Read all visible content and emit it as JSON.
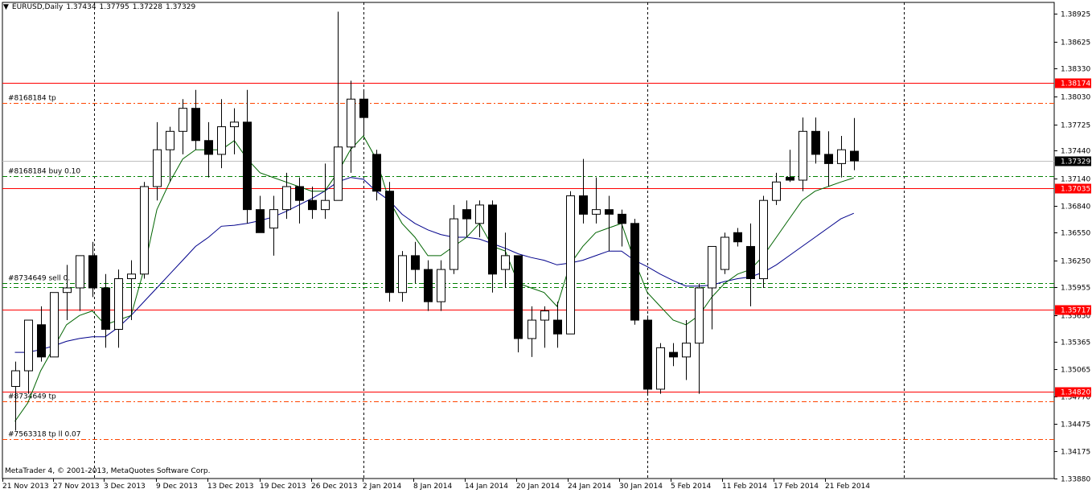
{
  "header": {
    "menu_icon": "triangle-down-icon",
    "symbol": "EURUSD,Daily",
    "open": "1.37434",
    "high": "1.37795",
    "low": "1.37228",
    "close": "1.37329"
  },
  "footer": {
    "copyright": "MetaTrader 4, © 2001-2013, MetaQuotes Software Corp."
  },
  "colors": {
    "bull": "#ffffff",
    "bear": "#000000",
    "ma_fast": "#006400",
    "ma_slow": "#00008b",
    "level": "#ff0000",
    "tp": "#ff4500",
    "buy": "#008000",
    "grid": "#000000",
    "bid": "#c0c0c0"
  },
  "chart_data": {
    "type": "candlestick",
    "ylim": [
      1.3388,
      1.3905
    ],
    "y_ticks": [
      "1.38925",
      "1.38625",
      "1.38330",
      "1.38030",
      "1.37725",
      "1.37440",
      "1.37140",
      "1.36840",
      "1.36550",
      "1.36250",
      "1.35955",
      "1.35650",
      "1.35365",
      "1.35065",
      "1.34770",
      "1.34475",
      "1.34175",
      "1.33880"
    ],
    "x_labels": [
      "21 Nov 2013",
      "27 Nov 2013",
      "3 Dec 2013",
      "9 Dec 2013",
      "13 Dec 2013",
      "19 Dec 2013",
      "26 Dec 2013",
      "2 Jan 2014",
      "8 Jan 2014",
      "14 Jan 2014",
      "20 Jan 2014",
      "24 Jan 2014",
      "30 Jan 2014",
      "5 Feb 2014",
      "11 Feb 2014",
      "17 Feb 2014",
      "21 Feb 2014"
    ],
    "candles": [
      [
        1.3488,
        1.3515,
        1.344,
        1.3505
      ],
      [
        1.3505,
        1.356,
        1.348,
        1.356
      ],
      [
        1.3555,
        1.3575,
        1.3515,
        1.352
      ],
      [
        1.352,
        1.359,
        1.352,
        1.359
      ],
      [
        1.359,
        1.362,
        1.356,
        1.3595
      ],
      [
        1.3595,
        1.363,
        1.357,
        1.363
      ],
      [
        1.363,
        1.3645,
        1.3585,
        1.3595
      ],
      [
        1.3595,
        1.361,
        1.353,
        1.355
      ],
      [
        1.355,
        1.3615,
        1.353,
        1.3605
      ],
      [
        1.3605,
        1.3625,
        1.356,
        1.361
      ],
      [
        1.361,
        1.371,
        1.3605,
        1.3705
      ],
      [
        1.3705,
        1.3775,
        1.369,
        1.3745
      ],
      [
        1.3745,
        1.377,
        1.371,
        1.3765
      ],
      [
        1.3765,
        1.38,
        1.374,
        1.379
      ],
      [
        1.379,
        1.381,
        1.3745,
        1.3755
      ],
      [
        1.3755,
        1.3775,
        1.3715,
        1.374
      ],
      [
        1.374,
        1.38,
        1.3725,
        1.377
      ],
      [
        1.377,
        1.379,
        1.374,
        1.3775
      ],
      [
        1.3775,
        1.381,
        1.3665,
        1.368
      ],
      [
        1.368,
        1.3695,
        1.3655,
        1.3655
      ],
      [
        1.366,
        1.3695,
        1.363,
        1.368
      ],
      [
        1.368,
        1.372,
        1.367,
        1.3705
      ],
      [
        1.3705,
        1.3715,
        1.3665,
        1.369
      ],
      [
        1.369,
        1.3705,
        1.367,
        1.368
      ],
      [
        1.368,
        1.373,
        1.367,
        1.369
      ],
      [
        1.369,
        1.3895,
        1.369,
        1.3748
      ],
      [
        1.3748,
        1.382,
        1.372,
        1.38
      ],
      [
        1.38,
        1.381,
        1.376,
        1.378
      ],
      [
        1.374,
        1.3745,
        1.369,
        1.37
      ],
      [
        1.37,
        1.371,
        1.358,
        1.359
      ],
      [
        1.359,
        1.3635,
        1.358,
        1.363
      ],
      [
        1.363,
        1.3645,
        1.36,
        1.3615
      ],
      [
        1.3615,
        1.3625,
        1.357,
        1.358
      ],
      [
        1.358,
        1.3625,
        1.357,
        1.3615
      ],
      [
        1.3615,
        1.3685,
        1.361,
        1.367
      ],
      [
        1.368,
        1.369,
        1.365,
        1.367
      ],
      [
        1.3665,
        1.369,
        1.365,
        1.3685
      ],
      [
        1.3685,
        1.369,
        1.359,
        1.361
      ],
      [
        1.3615,
        1.3655,
        1.3595,
        1.363
      ],
      [
        1.363,
        1.363,
        1.3525,
        1.354
      ],
      [
        1.354,
        1.3575,
        1.352,
        1.356
      ],
      [
        1.356,
        1.3575,
        1.353,
        1.357
      ],
      [
        1.356,
        1.358,
        1.353,
        1.3545
      ],
      [
        1.3545,
        1.37,
        1.3545,
        1.3695
      ],
      [
        1.3695,
        1.3735,
        1.3665,
        1.3675
      ],
      [
        1.3675,
        1.3715,
        1.3665,
        1.368
      ],
      [
        1.368,
        1.3695,
        1.3635,
        1.3675
      ],
      [
        1.3675,
        1.368,
        1.364,
        1.3665
      ],
      [
        1.3665,
        1.367,
        1.3555,
        1.356
      ],
      [
        1.356,
        1.3565,
        1.348,
        1.3485
      ],
      [
        1.3485,
        1.3535,
        1.348,
        1.353
      ],
      [
        1.3525,
        1.3535,
        1.351,
        1.352
      ],
      [
        1.352,
        1.356,
        1.3495,
        1.3535
      ],
      [
        1.3535,
        1.36,
        1.348,
        1.3595
      ],
      [
        1.3595,
        1.3635,
        1.355,
        1.364
      ],
      [
        1.3615,
        1.3655,
        1.361,
        1.365
      ],
      [
        1.3655,
        1.366,
        1.364,
        1.3645
      ],
      [
        1.364,
        1.3665,
        1.3575,
        1.3605
      ],
      [
        1.3605,
        1.3695,
        1.3595,
        1.369
      ],
      [
        1.369,
        1.372,
        1.3685,
        1.371
      ],
      [
        1.3715,
        1.3745,
        1.371,
        1.3712
      ],
      [
        1.3712,
        1.378,
        1.37,
        1.3765
      ],
      [
        1.3765,
        1.378,
        1.373,
        1.374
      ],
      [
        1.374,
        1.3765,
        1.3705,
        1.373
      ],
      [
        1.373,
        1.376,
        1.3715,
        1.3745
      ],
      [
        1.37434,
        1.37795,
        1.37228,
        1.37329
      ]
    ],
    "ma_fast": [
      1.345,
      1.347,
      1.3505,
      1.353,
      1.3555,
      1.3565,
      1.357,
      1.3555,
      1.356,
      1.3565,
      1.3615,
      1.368,
      1.371,
      1.3735,
      1.3745,
      1.3745,
      1.3745,
      1.3755,
      1.3735,
      1.372,
      1.3715,
      1.371,
      1.3705,
      1.37,
      1.37,
      1.372,
      1.3745,
      1.376,
      1.3735,
      1.369,
      1.3665,
      1.365,
      1.363,
      1.363,
      1.364,
      1.365,
      1.3665,
      1.364,
      1.3635,
      1.36,
      1.3595,
      1.359,
      1.3575,
      1.362,
      1.364,
      1.3655,
      1.366,
      1.3665,
      1.3625,
      1.359,
      1.3575,
      1.356,
      1.3555,
      1.3565,
      1.3585,
      1.36,
      1.361,
      1.3615,
      1.363,
      1.365,
      1.367,
      1.369,
      1.37,
      1.3705,
      1.371,
      1.37145
    ],
    "ma_slow": [
      1.3525,
      1.3525,
      1.3528,
      1.3532,
      1.3537,
      1.354,
      1.3542,
      1.3542,
      1.3552,
      1.3565,
      1.358,
      1.3595,
      1.361,
      1.3625,
      1.364,
      1.365,
      1.3662,
      1.3663,
      1.3665,
      1.3668,
      1.3672,
      1.3678,
      1.3685,
      1.3692,
      1.37,
      1.371,
      1.3715,
      1.3713,
      1.37,
      1.369,
      1.3675,
      1.3665,
      1.3658,
      1.3653,
      1.365,
      1.365,
      1.3648,
      1.3643,
      1.3638,
      1.3632,
      1.3628,
      1.3625,
      1.362,
      1.3622,
      1.3625,
      1.363,
      1.3635,
      1.3635,
      1.3625,
      1.3618,
      1.361,
      1.3603,
      1.3597,
      1.3597,
      1.3598,
      1.3602,
      1.3605,
      1.3607,
      1.3612,
      1.362,
      1.363,
      1.364,
      1.365,
      1.366,
      1.367,
      1.3676
    ],
    "levels": [
      {
        "price": 1.38174,
        "label": "1.38174",
        "style": "solid",
        "color_key": "level"
      },
      {
        "price": 1.37035,
        "label": "1.37035",
        "style": "solid",
        "color_key": "level"
      },
      {
        "price": 1.35717,
        "label": "1.35717",
        "style": "solid",
        "color_key": "level"
      },
      {
        "price": 1.3482,
        "label": "1.34820",
        "style": "solid",
        "color_key": "level"
      }
    ],
    "orders": [
      {
        "price": 1.3796,
        "text": "#8168184 tp",
        "color_key": "tp"
      },
      {
        "price": 1.3716,
        "text": "#8168184 buy 0.10",
        "color_key": "buy"
      },
      {
        "price": 1.36,
        "text": "#8734649 sell 0.",
        "color_key": "buy"
      },
      {
        "price": 1.3596,
        "text": "",
        "color_key": "buy"
      },
      {
        "price": 1.3472,
        "text": "#8734649 tp",
        "color_key": "tp"
      },
      {
        "price": 1.3431,
        "text": "#7563318 tp ll 0.07",
        "color_key": "tp"
      }
    ],
    "bid": {
      "price": 1.37329,
      "label": "1.37329"
    }
  }
}
